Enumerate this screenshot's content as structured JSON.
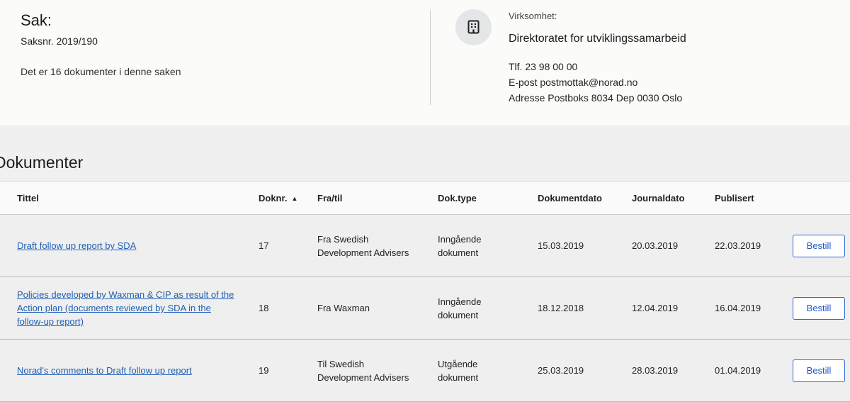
{
  "case": {
    "title": "Sak:",
    "number": "Saksnr. 2019/190",
    "doc_count": "Det er 16 dokumenter i denne saken"
  },
  "org": {
    "icon": "building-icon",
    "label": "Virksomhet:",
    "name": "Direktoratet for utviklingssamarbeid",
    "phone": "Tlf. 23 98 00 00",
    "email": "E-post postmottak@norad.no",
    "address": "Adresse Postboks 8034 Dep 0030 Oslo"
  },
  "documents": {
    "heading": "Dokumenter",
    "columns": [
      "Tittel",
      "Doknr.",
      "Fra/til",
      "Dok.type",
      "Dokumentdato",
      "Journaldato",
      "Publisert"
    ],
    "sort_icon": "sort-ascending-icon",
    "rows": [
      {
        "title": "Draft follow up report by SDA",
        "docnr": "17",
        "from_to": "Fra Swedish Development Advisers",
        "type": "Inngående dokument",
        "doc_date": "15.03.2019",
        "journal_date": "20.03.2019",
        "published": "22.03.2019",
        "action": "Bestill"
      },
      {
        "title": "Policies developed by Waxman & CIP as result of the Action plan (documents reviewed by SDA in the follow-up report)",
        "docnr": "18",
        "from_to": "Fra Waxman",
        "type": "Inngående dokument",
        "doc_date": "18.12.2018",
        "journal_date": "12.04.2019",
        "published": "16.04.2019",
        "action": "Bestill"
      },
      {
        "title": "Norad's comments to Draft follow up report",
        "docnr": "19",
        "from_to": "Til Swedish Development Advisers",
        "type": "Utgående dokument",
        "doc_date": "25.03.2019",
        "journal_date": "28.03.2019",
        "published": "01.04.2019",
        "action": "Bestill"
      }
    ]
  }
}
